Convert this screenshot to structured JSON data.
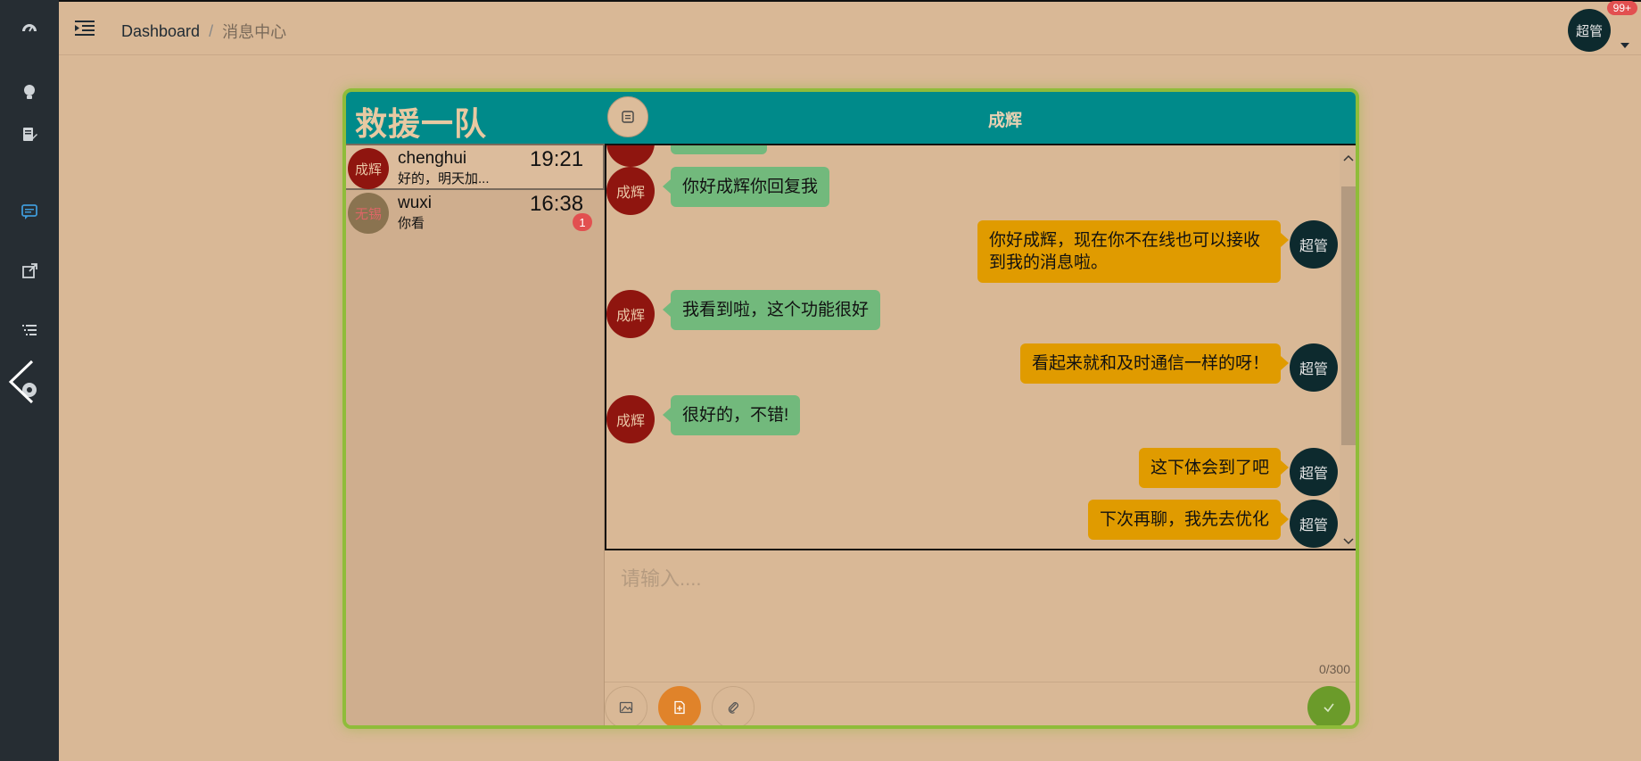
{
  "header": {
    "breadcrumb_home": "Dashboard",
    "breadcrumb_sep": "/",
    "breadcrumb_current": "消息中心",
    "user_avatar": "超管",
    "notification_badge": "99+"
  },
  "sidebar": {
    "icons": [
      "dashboard-icon",
      "lightbulb-icon",
      "edit-doc-icon",
      "chat-icon",
      "external-link-icon",
      "list-icon",
      "compass-icon"
    ]
  },
  "chat": {
    "team_title": "救援一队",
    "chat_with": "成辉",
    "contacts": [
      {
        "avatar": "成辉",
        "name": "chenghui",
        "preview": "好的，明天加...",
        "time": "19:21",
        "unread": ""
      },
      {
        "avatar": "无锡",
        "name": "wuxi",
        "preview": "你看",
        "time": "16:38",
        "unread": "1"
      }
    ],
    "messages": [
      {
        "side": "left",
        "avatar": "成辉",
        "text": "你好成辉你回复我"
      },
      {
        "side": "right",
        "avatar": "超管",
        "text": "你好成辉，现在你不在线也可以接收到我的消息啦。"
      },
      {
        "side": "left",
        "avatar": "成辉",
        "text": "我看到啦，这个功能很好"
      },
      {
        "side": "right",
        "avatar": "超管",
        "text": "看起来就和及时通信一样的呀！"
      },
      {
        "side": "left",
        "avatar": "成辉",
        "text": "很好的，不错!"
      },
      {
        "side": "right",
        "avatar": "超管",
        "text": "这下体会到了吧"
      },
      {
        "side": "right",
        "avatar": "超管",
        "text": "下次再聊，我先去优化"
      }
    ],
    "input_placeholder": "请输入....",
    "char_counter": "0/300"
  },
  "colors": {
    "page_bg": "#d9b896",
    "sidebar_bg": "#262d33",
    "card_header": "#008a8a",
    "bubble_left": "#72b97c",
    "bubble_right": "#e09b00",
    "send_button": "#6b9b2a"
  }
}
